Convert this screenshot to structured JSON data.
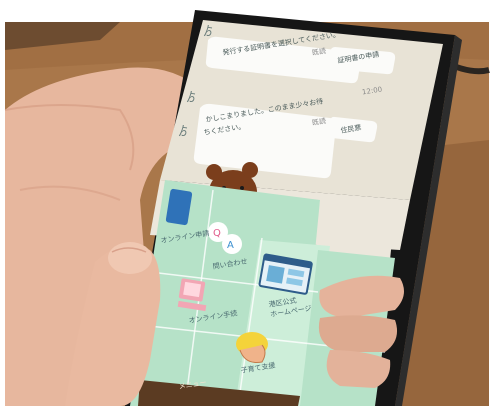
{
  "chat": {
    "user_msg_1": "証明書の申請",
    "bot_msg_1": "発行する証明書を選択してください。",
    "user_msg_2": "住民票",
    "bot_msg_2_line1": "かしこまりました。このまま少々お待",
    "bot_msg_2_line2": "ちください。",
    "read_label": "既読",
    "time_label": "12:00"
  },
  "menu": {
    "items": [
      {
        "label": "オンライン申請"
      },
      {
        "label": "問い合わせ"
      },
      {
        "label": "港区公式\nホームページ"
      },
      {
        "label": "オンライン手続"
      },
      {
        "label": "子育て支援"
      }
    ],
    "footer_label": "メニュー"
  },
  "colors": {
    "wood": "#a9774a",
    "chat_bg": "#e8e3d6",
    "menu_bg": "#b6e2c8",
    "bubble": "#fbfbf9",
    "phone_frame": "#161616"
  }
}
